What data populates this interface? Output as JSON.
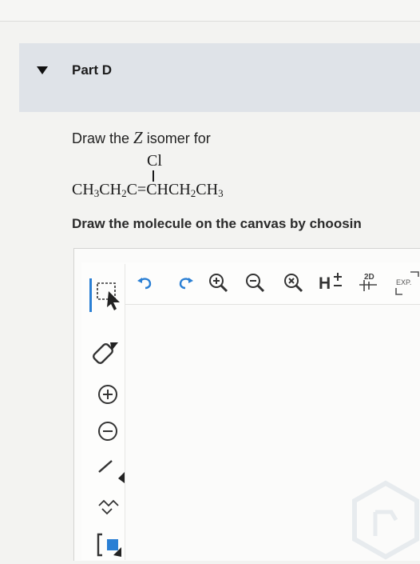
{
  "part": {
    "title": "Part D"
  },
  "question": {
    "prompt_prefix": "Draw the ",
    "isomer": "Z",
    "prompt_suffix": " isomer for",
    "substituent": "Cl",
    "instruction": "Draw the molecule on the canvas by choosin"
  },
  "toolbar": {
    "tools": [
      "new-document-icon",
      "undo-icon",
      "redo-icon",
      "zoom-in-icon",
      "zoom-out-icon",
      "zoom-reset-icon",
      "hydrogen-toggle-icon",
      "clean-2d-icon",
      "expand-icon"
    ],
    "h_label": "H",
    "label_2d": "2D",
    "expand_label": "EXP."
  },
  "sidebar": {
    "tools": [
      "selection-tool-icon",
      "eraser-icon",
      "positive-charge-icon",
      "negative-charge-icon",
      "single-bond-icon",
      "chain-tool-icon",
      "bracket-tool-icon"
    ]
  },
  "colors": {
    "accent": "#2a7fd4",
    "header_bg": "#dfe3e8"
  }
}
